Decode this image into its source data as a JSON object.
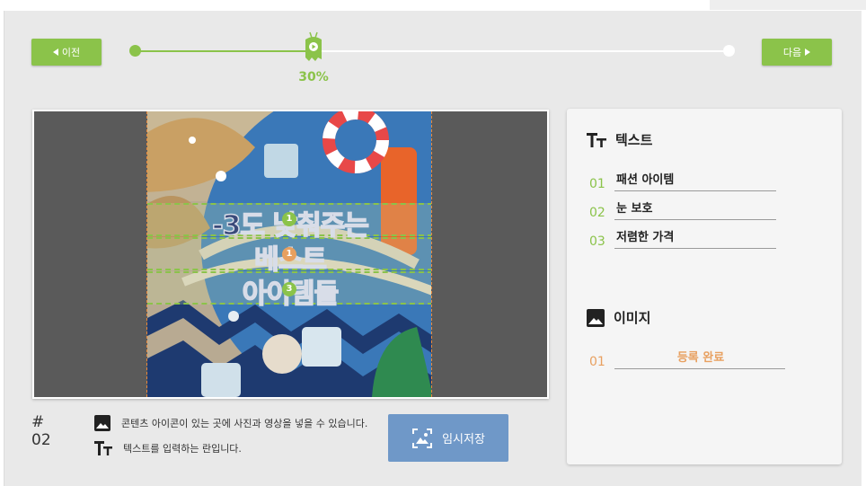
{
  "nav": {
    "prev_label": "이전",
    "next_label": "다음"
  },
  "progress": {
    "value": 0.3,
    "label": "30%"
  },
  "canvas": {
    "lines": [
      "-3도 낮춰주는",
      "베스트",
      "아이템들"
    ],
    "badges": [
      "1",
      "1",
      "3"
    ]
  },
  "info": {
    "slide_number": "# 02",
    "image_hint": "콘텐츠 아이콘이 있는 곳에 사진과 영상을 넣을 수 있습니다.",
    "text_hint": "텍스트를 입력하는 란입니다."
  },
  "save_label": "임시저장",
  "panel": {
    "text_section_title": "텍스트",
    "text_fields": [
      {
        "num": "01",
        "value": "패션 아이템"
      },
      {
        "num": "02",
        "value": "눈 보호"
      },
      {
        "num": "03",
        "value": "저렴한 가격"
      }
    ],
    "image_section_title": "이미지",
    "image_fields": [
      {
        "num": "01",
        "value": "등록 완료"
      }
    ]
  },
  "colors": {
    "accent": "#8bc34a",
    "save": "#6f98c8",
    "done": "#e8a060"
  }
}
